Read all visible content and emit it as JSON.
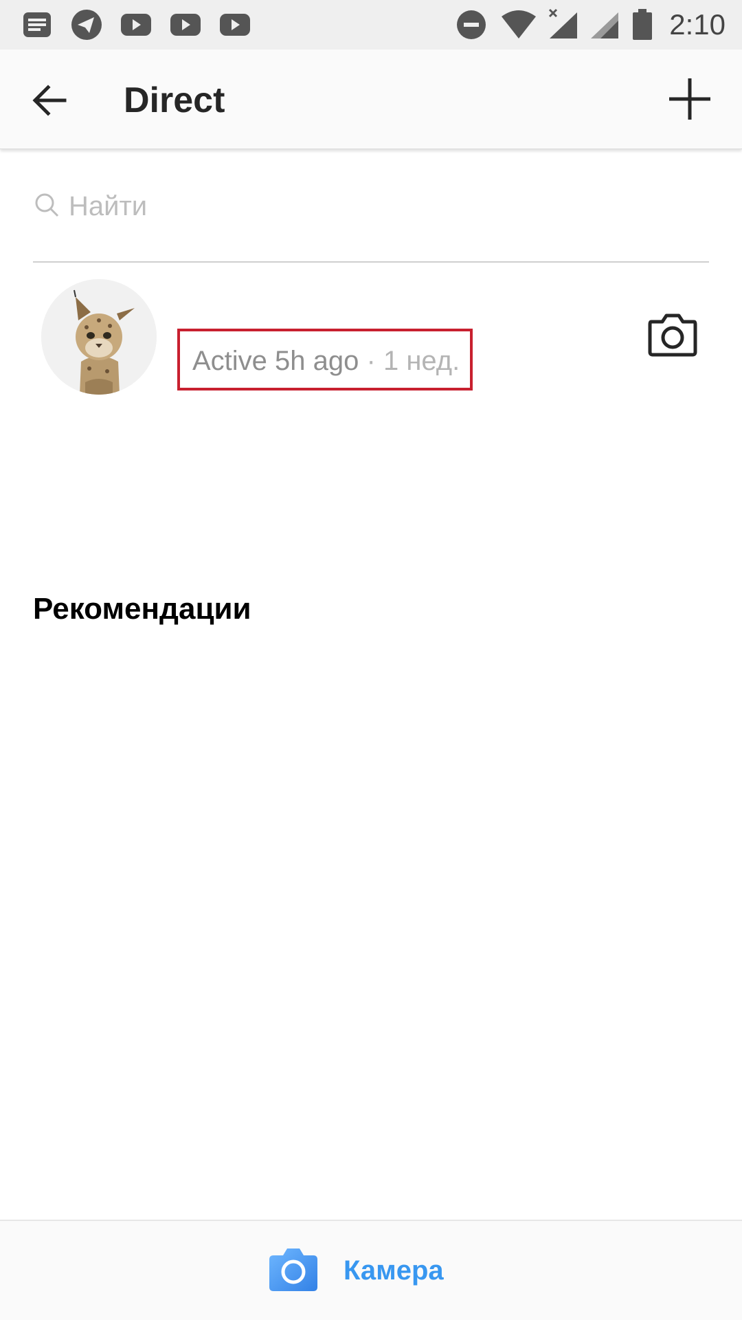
{
  "status_bar": {
    "time": "2:10",
    "left_icons": [
      "notes-icon",
      "telegram-icon",
      "youtube-icon",
      "youtube-icon",
      "youtube-icon"
    ],
    "right_icons": [
      "do-not-disturb-icon",
      "wifi-icon",
      "signal-icon",
      "signal-icon",
      "battery-icon"
    ]
  },
  "header": {
    "title": "Direct"
  },
  "search": {
    "placeholder": "Найти",
    "value": ""
  },
  "threads": [
    {
      "active_status": "Active 5h ago",
      "separator": "·",
      "time": "1 нед."
    }
  ],
  "recommendations": {
    "title": "Рекомендации"
  },
  "bottom_bar": {
    "camera_label": "Камера",
    "accent_color": "#3897f0"
  },
  "colors": {
    "highlight_box": "#c8202f"
  }
}
